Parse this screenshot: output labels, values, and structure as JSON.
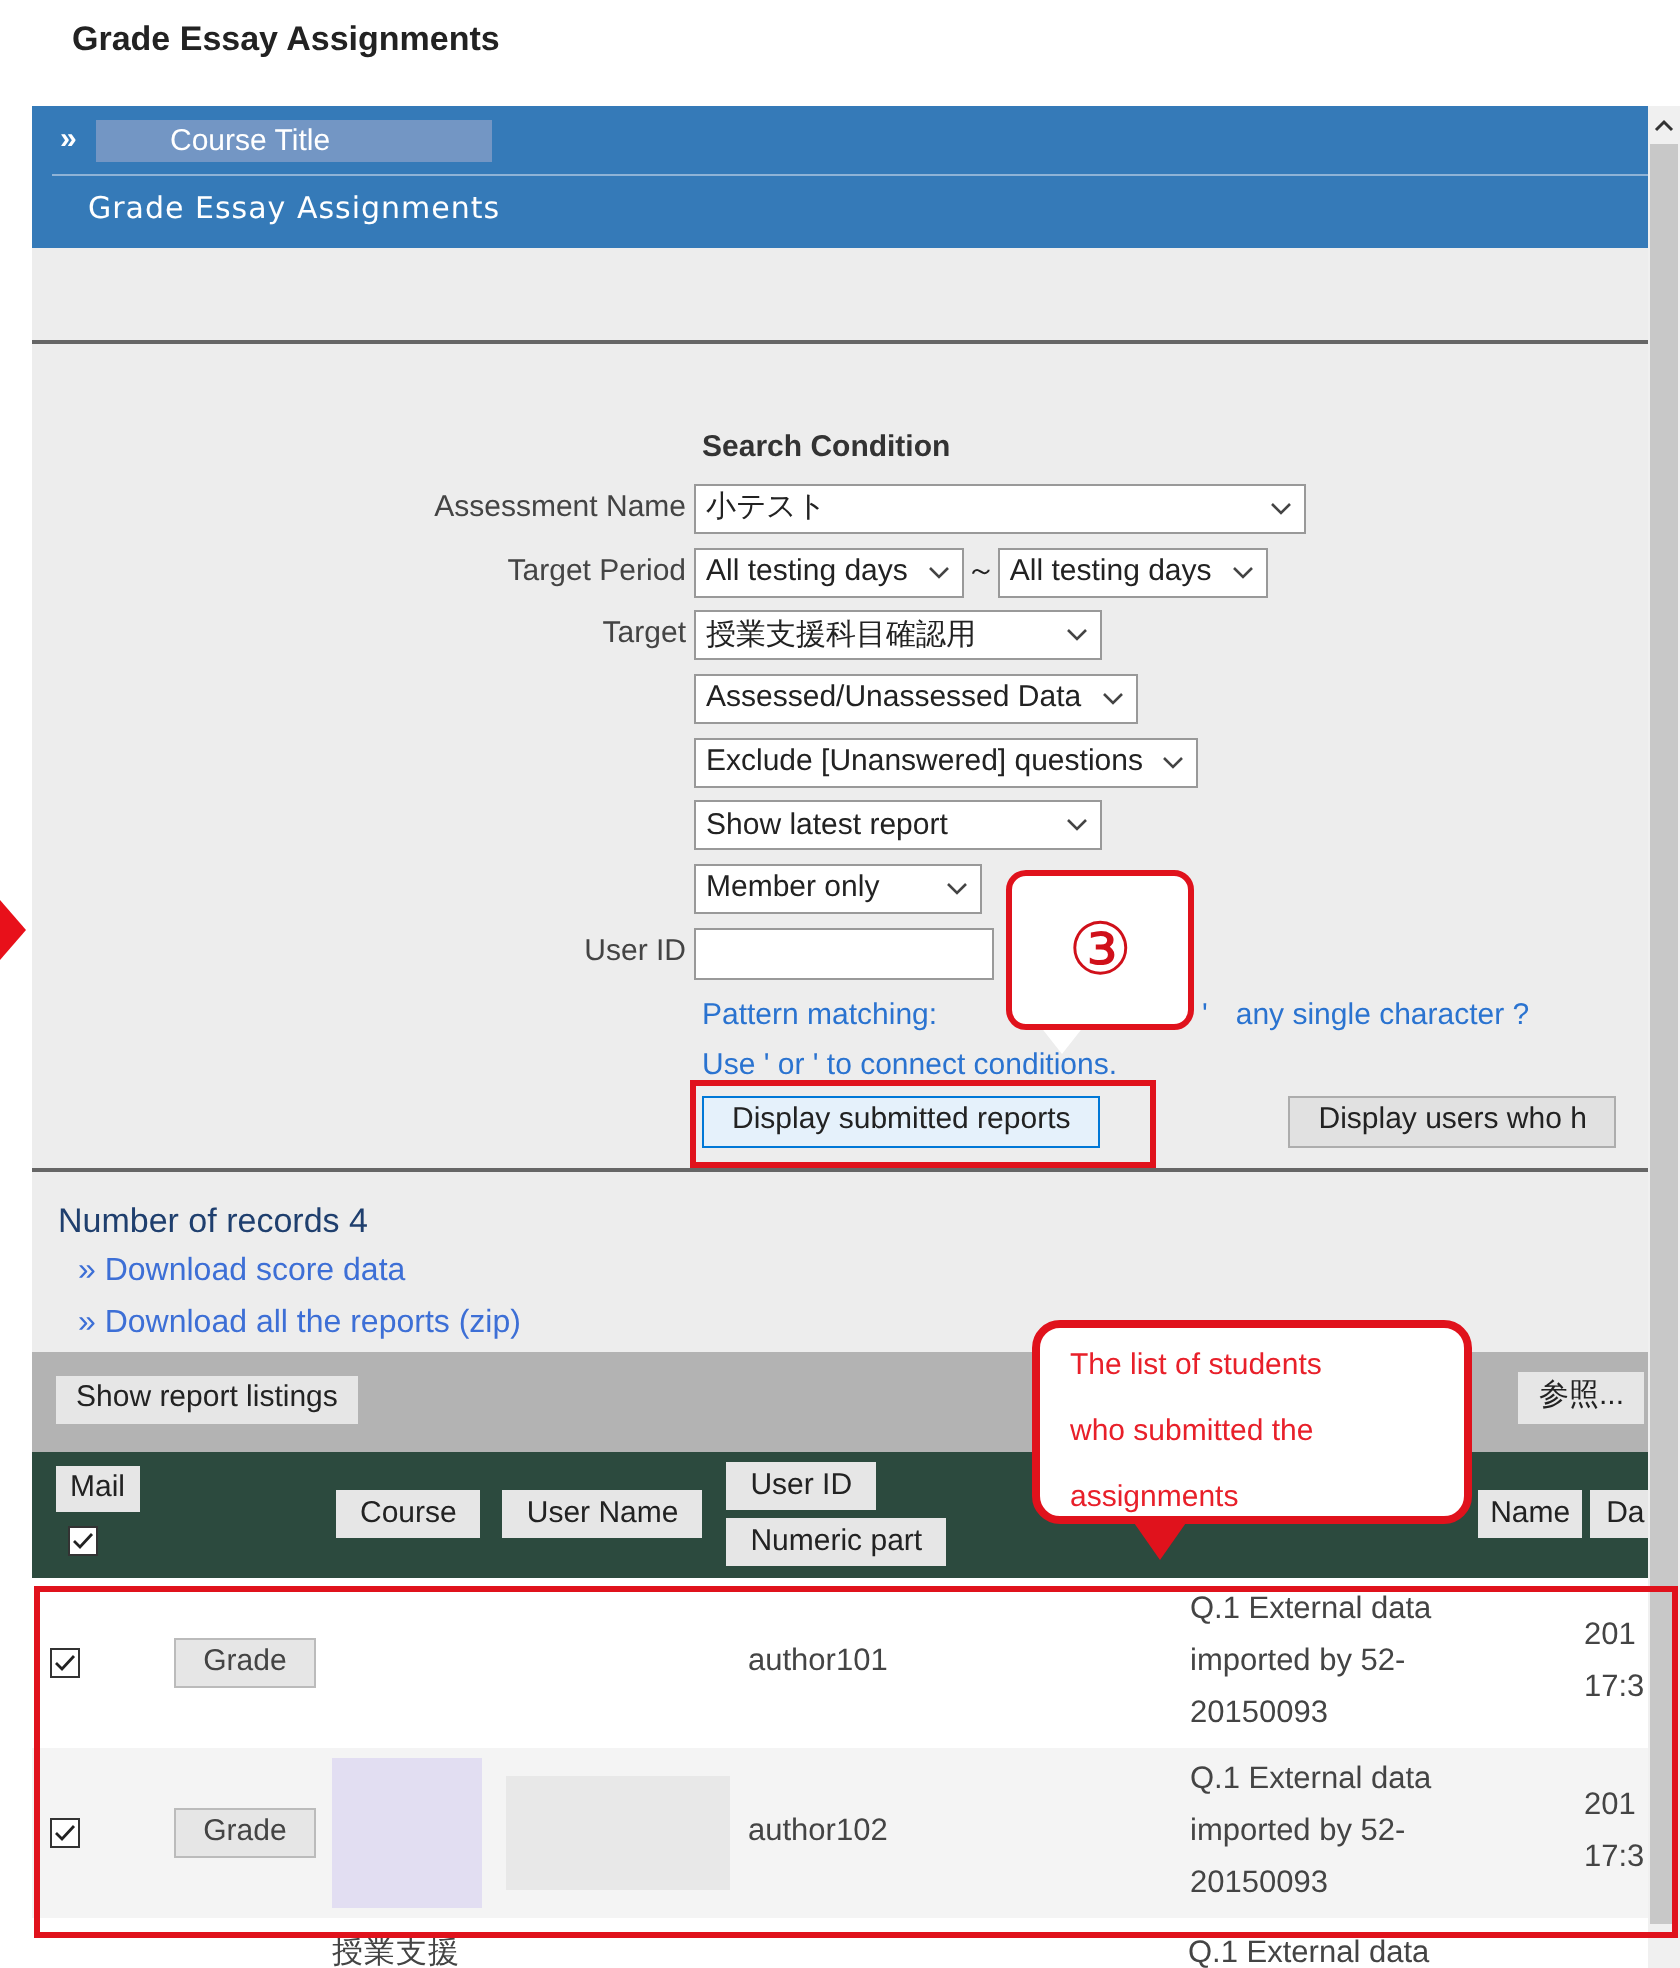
{
  "page_title": "Grade Essay Assignments",
  "header": {
    "breadcrumb_icon": "»",
    "course_title": "Course Title",
    "subtitle": "Grade Essay Assignments"
  },
  "search": {
    "heading": "Search Condition",
    "rows": [
      {
        "label": "Assessment Name",
        "kind": "select",
        "selects": [
          "小テスト"
        ]
      },
      {
        "label": "Target Period",
        "kind": "select",
        "selects": [
          "All testing days",
          "All testing days"
        ],
        "separator": "～"
      },
      {
        "label": "Target",
        "kind": "select",
        "selects": [
          "授業支援科目確認用"
        ]
      },
      {
        "kind": "select",
        "selects": [
          "Assessed/Unassessed Data"
        ]
      },
      {
        "kind": "select",
        "selects": [
          "Exclude [Unanswered] questions"
        ]
      },
      {
        "kind": "select",
        "selects": [
          "Show latest report"
        ]
      },
      {
        "kind": "select",
        "selects": [
          "Member only"
        ]
      },
      {
        "label": "User ID",
        "kind": "input"
      }
    ],
    "hint_line_1": [
      "Pattern matching:",
      "'",
      "any single character ?"
    ],
    "hint_line_2": "Use ' or ' to connect conditions.",
    "buttons": [
      {
        "label": "Display submitted reports",
        "highlighted": true
      },
      {
        "label": "Display users who h",
        "highlighted": false
      }
    ]
  },
  "records": {
    "count_text": "Number of records 4",
    "links": [
      "» Download score data",
      "» Download all the reports (zip)"
    ]
  },
  "toolbar": {
    "left_button": "Show report listings",
    "right_button": "参照..."
  },
  "table": {
    "mail": {
      "label": "Mail",
      "checked": true
    },
    "columns": [
      {
        "labels": [
          "Course"
        ]
      },
      {
        "labels": [
          "User Name"
        ]
      },
      {
        "labels": [
          "User ID",
          "Numeric part"
        ]
      },
      {
        "labels": [
          "Name"
        ]
      },
      {
        "labels": [
          "Da"
        ]
      }
    ],
    "rows": [
      {
        "checked": true,
        "action": "Grade",
        "redacted": false,
        "user_id": "author101",
        "title": "Q.1 External data imported by 52-20150093",
        "date_lines": [
          "201",
          "17:3"
        ]
      },
      {
        "checked": true,
        "action": "Grade",
        "redacted": true,
        "user_id": "author102",
        "title": "Q.1 External data imported by 52-20150093",
        "date_lines": [
          "201",
          "17:3"
        ]
      }
    ],
    "partial_row": {
      "course": "授業支援",
      "title": "Q.1 External data"
    }
  },
  "annotations": [
    {
      "kind": "bubble",
      "text": "③"
    },
    {
      "kind": "callout",
      "text": "The list of students who submitted the assignments"
    }
  ]
}
